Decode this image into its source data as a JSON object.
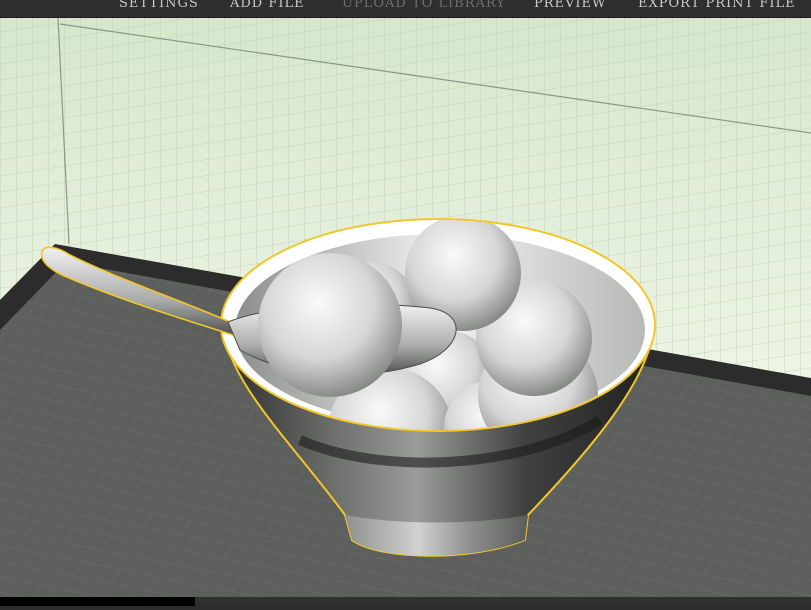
{
  "menu": {
    "items": [
      {
        "label": "SETTINGS",
        "enabled": true
      },
      {
        "label": "ADD FILE",
        "enabled": true
      },
      {
        "label": "UPLOAD TO LIBRARY",
        "enabled": false
      },
      {
        "label": "PREVIEW",
        "enabled": true
      },
      {
        "label": "EXPORT PRINT FILE",
        "enabled": true
      }
    ]
  },
  "viewport": {
    "wall_color": "#e7f1df",
    "floor_color": "#5c5e5c",
    "selection_outline_color": "#f2c62a",
    "model_color": "#d9d9d9",
    "objects": [
      "bowl",
      "spoon",
      "spheres"
    ]
  },
  "status": {
    "progress": 0.24
  }
}
